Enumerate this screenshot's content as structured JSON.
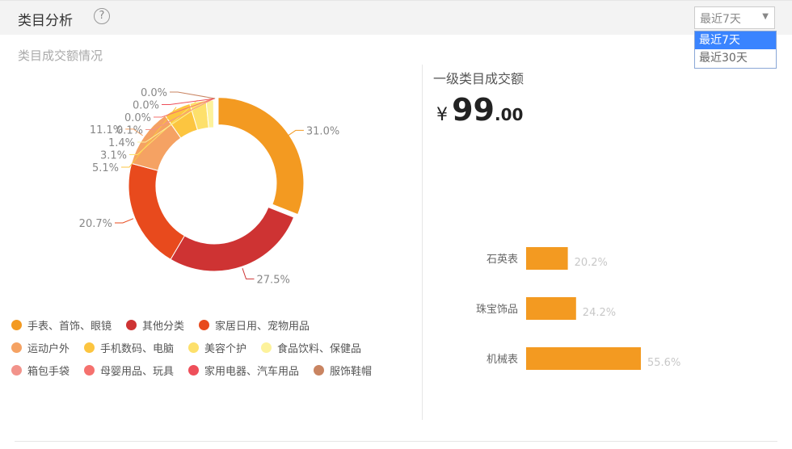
{
  "header": {
    "title": "类目分析",
    "help_icon": "question-circle-icon",
    "range_select": {
      "value": "最近7天",
      "options": [
        "最近7天",
        "最近30天"
      ],
      "selected_index": 0
    }
  },
  "left_panel": {
    "subtitle": "类目成交额情况"
  },
  "right_panel": {
    "title": "一级类目成交额",
    "total": {
      "symbol": "¥",
      "integer": "99",
      "decimal": ".00"
    }
  },
  "colors": {
    "accent_bar": "#f39a21",
    "bar_label": "#c8c8c8",
    "option_selected": "#3a84ff"
  },
  "chart_data": [
    {
      "type": "pie",
      "style": "donut",
      "categories": [
        "手表、首饰、眼镜",
        "其他分类",
        "家居日用、宠物用品",
        "运动户外",
        "手机数码、电脑",
        "美容个护",
        "食品饮料、保健品",
        "箱包手袋",
        "母婴用品、玩具",
        "家用电器、汽车用品",
        "服饰鞋帽"
      ],
      "values": [
        31.0,
        27.5,
        20.7,
        11.1,
        5.1,
        3.1,
        1.4,
        0.1,
        0.0,
        0.0,
        0.0
      ],
      "labels": [
        "31.0%",
        "27.5%",
        "20.7%",
        "11.1%",
        "5.1%",
        "3.1%",
        "1.4%",
        "0.1%",
        "0.0%",
        "0.0%",
        "0.0%"
      ],
      "colors": [
        "#f39a21",
        "#ce3333",
        "#e84a1d",
        "#f5a263",
        "#fcc540",
        "#fde06b",
        "#fdf29b",
        "#f2938b",
        "#f5716e",
        "#ee4f5a",
        "#c98461"
      ],
      "legend_position": "bottom"
    },
    {
      "type": "bar",
      "orientation": "horizontal",
      "categories": [
        "石英表",
        "珠宝饰品",
        "机械表"
      ],
      "values": [
        20.2,
        24.2,
        55.6
      ],
      "labels": [
        "20.2%",
        "24.2%",
        "55.6%"
      ]
    }
  ]
}
